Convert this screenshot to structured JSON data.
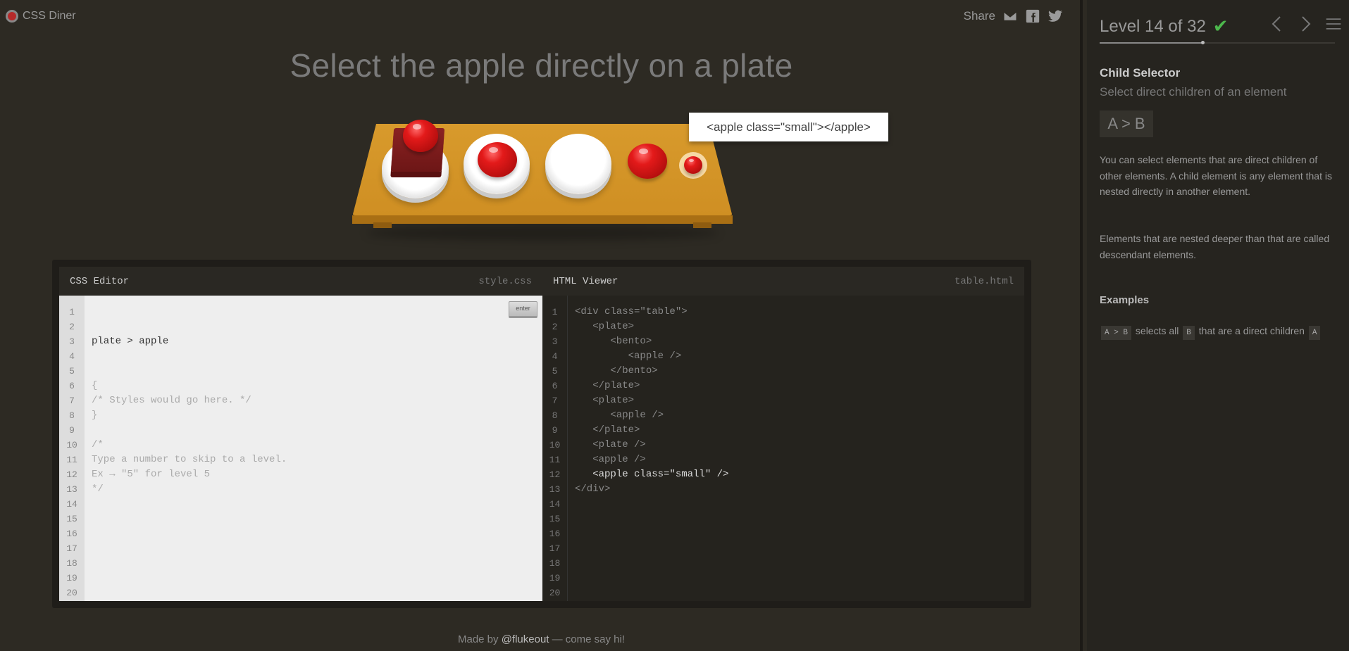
{
  "app": {
    "logo_text": "CSS Diner"
  },
  "share": {
    "label": "Share",
    "icons": [
      "mail-icon",
      "facebook-icon",
      "twitter-icon"
    ]
  },
  "order": "Select the apple directly on a plate",
  "tooltip": "<apple class=\"small\"></apple>",
  "css_editor": {
    "title": "CSS Editor",
    "file": "style.css",
    "input": "plate > apple",
    "enter_label": "enter",
    "lines": [
      "{",
      "/* Styles would go here. */",
      "}",
      "",
      "/*",
      "Type a number to skip to a level.",
      "Ex → \"5\" for level 5",
      "*/"
    ],
    "line_numbers": "1\n2\n3\n4\n5\n6\n7\n8\n9\n10\n11\n12\n13\n14\n15\n16\n17\n18\n19\n20"
  },
  "html_viewer": {
    "title": "HTML Viewer",
    "file": "table.html",
    "lines": [
      "<div class=\"table\">",
      "   <plate>",
      "      <bento>",
      "         <apple />",
      "      </bento>",
      "   </plate>",
      "   <plate>",
      "      <apple />",
      "   </plate>",
      "   <plate />",
      "   <apple />",
      "   <apple class=\"small\" />",
      "</div>"
    ],
    "highlight_line": 12,
    "line_numbers": "1\n2\n3\n4\n5\n6\n7\n8\n9\n10\n11\n12\n13\n14\n15\n16\n17\n18\n19\n20"
  },
  "footer": {
    "prefix": "Made by ",
    "link": "@flukeout",
    "suffix": " — come say hi!"
  },
  "sidebar": {
    "level_text": "Level 14 of 32",
    "level_complete": true,
    "progress": {
      "current": 14,
      "total": 32
    },
    "selector_name": "Child Selector",
    "title": "Select direct children of an element",
    "syntax": "A > B",
    "description_1": "You can select elements that are direct children of other elements. A child element is any element that is nested directly in another element.",
    "description_2": "Elements that are nested deeper than that are called descendant elements.",
    "examples_title": "Examples",
    "example": {
      "code_a": "A > B",
      "text_1": "selects all",
      "code_b": "B",
      "text_2": "that are a direct children",
      "code_c": "A"
    }
  },
  "colors": {
    "apple_red": "#e31a1a",
    "table": "#d89a2c",
    "check_green": "#4cb84c",
    "background": "#2d2a23"
  }
}
